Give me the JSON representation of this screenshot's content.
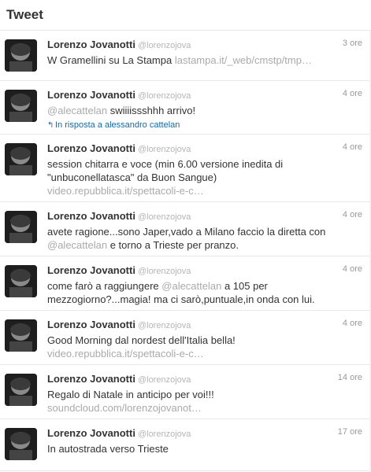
{
  "header": {
    "title": "Tweet"
  },
  "tweets": [
    {
      "name": "Lorenzo Jovanotti",
      "handle": "@lorenzojova",
      "time": "3 ore",
      "t1": "W Gramellini su La Stampa ",
      "link1": "lastampa.it/_web/cmstp/tmp…"
    },
    {
      "name": "Lorenzo Jovanotti",
      "handle": "@lorenzojova",
      "time": "4 ore",
      "mention": "@alecattelan",
      "t1": " swiiiissshhh arrivo!",
      "reply": "In risposta a alessandro cattelan"
    },
    {
      "name": "Lorenzo Jovanotti",
      "handle": "@lorenzojova",
      "time": "4 ore",
      "t1": "session chitarra e voce (min 6.00 versione inedita di \"unbuconellatasca\" da Buon Sangue)",
      "link1": "video.repubblica.it/spettacoli-e-c…"
    },
    {
      "name": "Lorenzo Jovanotti",
      "handle": "@lorenzojova",
      "time": "4 ore",
      "t1": "avete ragione...sono Japer,vado a Milano faccio la diretta con ",
      "mention": "@alecattelan",
      "t2": " e torno a Trieste per pranzo."
    },
    {
      "name": "Lorenzo Jovanotti",
      "handle": "@lorenzojova",
      "time": "4 ore",
      "t1": "come farò a raggiungere ",
      "mention": "@alecattelan",
      "t2": " a 105 per mezzogiorno?...magia! ma ci sarò,puntuale,in onda con lui."
    },
    {
      "name": "Lorenzo Jovanotti",
      "handle": "@lorenzojova",
      "time": "4 ore",
      "t1": "Good Morning dal nordest dell'Italia bella!",
      "link1": "video.repubblica.it/spettacoli-e-c…"
    },
    {
      "name": "Lorenzo Jovanotti",
      "handle": "@lorenzojova",
      "time": "14 ore",
      "t1": "Regalo di Natale in anticipo per voi!!!",
      "link1": "soundcloud.com/lorenzojovanot…"
    },
    {
      "name": "Lorenzo Jovanotti",
      "handle": "@lorenzojova",
      "time": "17 ore",
      "t1": "In autostrada verso Trieste"
    }
  ]
}
